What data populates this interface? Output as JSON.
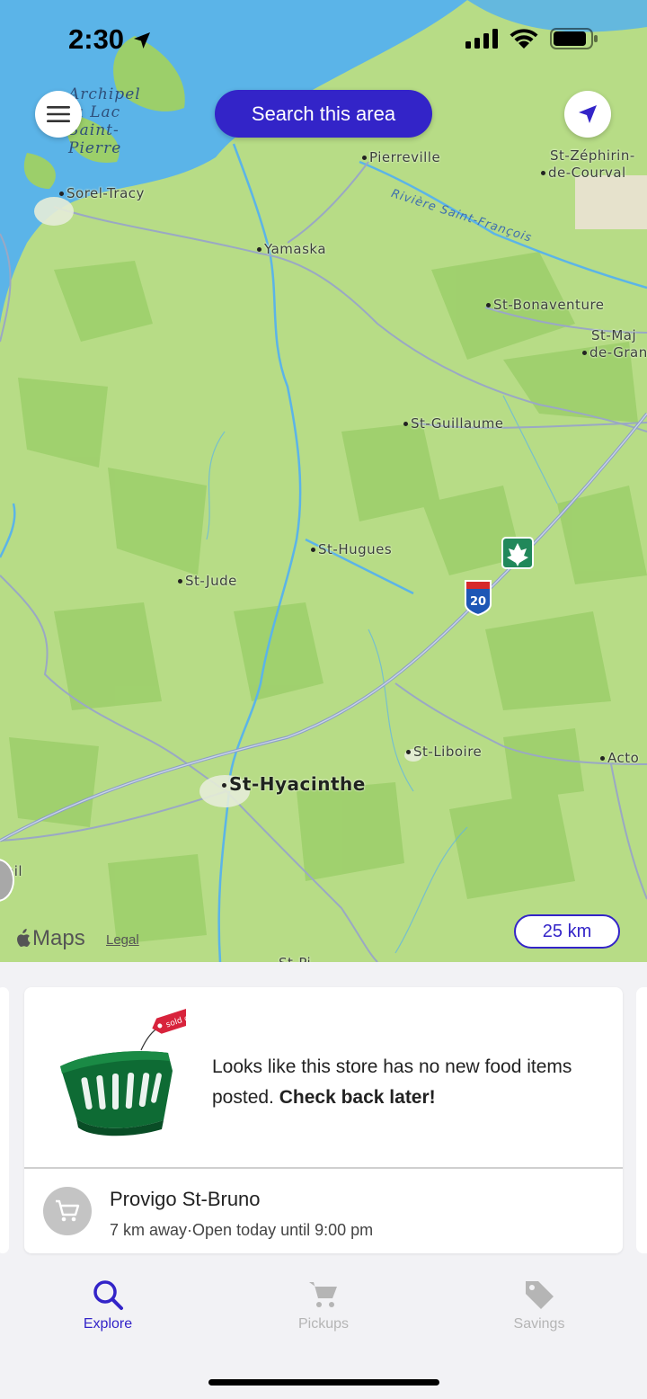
{
  "status_bar": {
    "time": "2:30"
  },
  "map": {
    "search_button_label": "Search this area",
    "scale_label": "25 km",
    "attribution": {
      "logo": "Maps",
      "legal": "Legal"
    },
    "water_label": [
      "Archipel",
      "du Lac",
      "Saint-",
      "Pierre"
    ],
    "river_label": "Rivière Saint-François",
    "places": [
      "Sorel-Tracy",
      "Pierreville",
      "St-Zéphirin-",
      "de-Courval",
      "Yamaska",
      "St-Bonaventure",
      "St-Maj",
      "de-Gran",
      "St-Guillaume",
      "St-Hugues",
      "St-Jude",
      "St-Liboire",
      "Acto",
      "St-Hyacinthe",
      "eil",
      "St-Pi"
    ],
    "highway_shield": "20",
    "colors": {
      "land": "#b7dc86",
      "water": "#5bb4e8",
      "road": "#9aa8c4",
      "accent": "#3324c8"
    }
  },
  "store_card": {
    "message_plain": "Looks like this store has no new food items posted. ",
    "message_bold": "Check back later!",
    "tag_text": "sold out",
    "store_name": "Provigo St-Bruno",
    "distance": "7 km away",
    "separator": "·",
    "hours": "Open today until 9:00 pm"
  },
  "tabs": [
    {
      "label": "Explore",
      "icon": "search-icon",
      "active": true
    },
    {
      "label": "Pickups",
      "icon": "cart-icon",
      "active": false
    },
    {
      "label": "Savings",
      "icon": "tag-icon",
      "active": false
    }
  ]
}
